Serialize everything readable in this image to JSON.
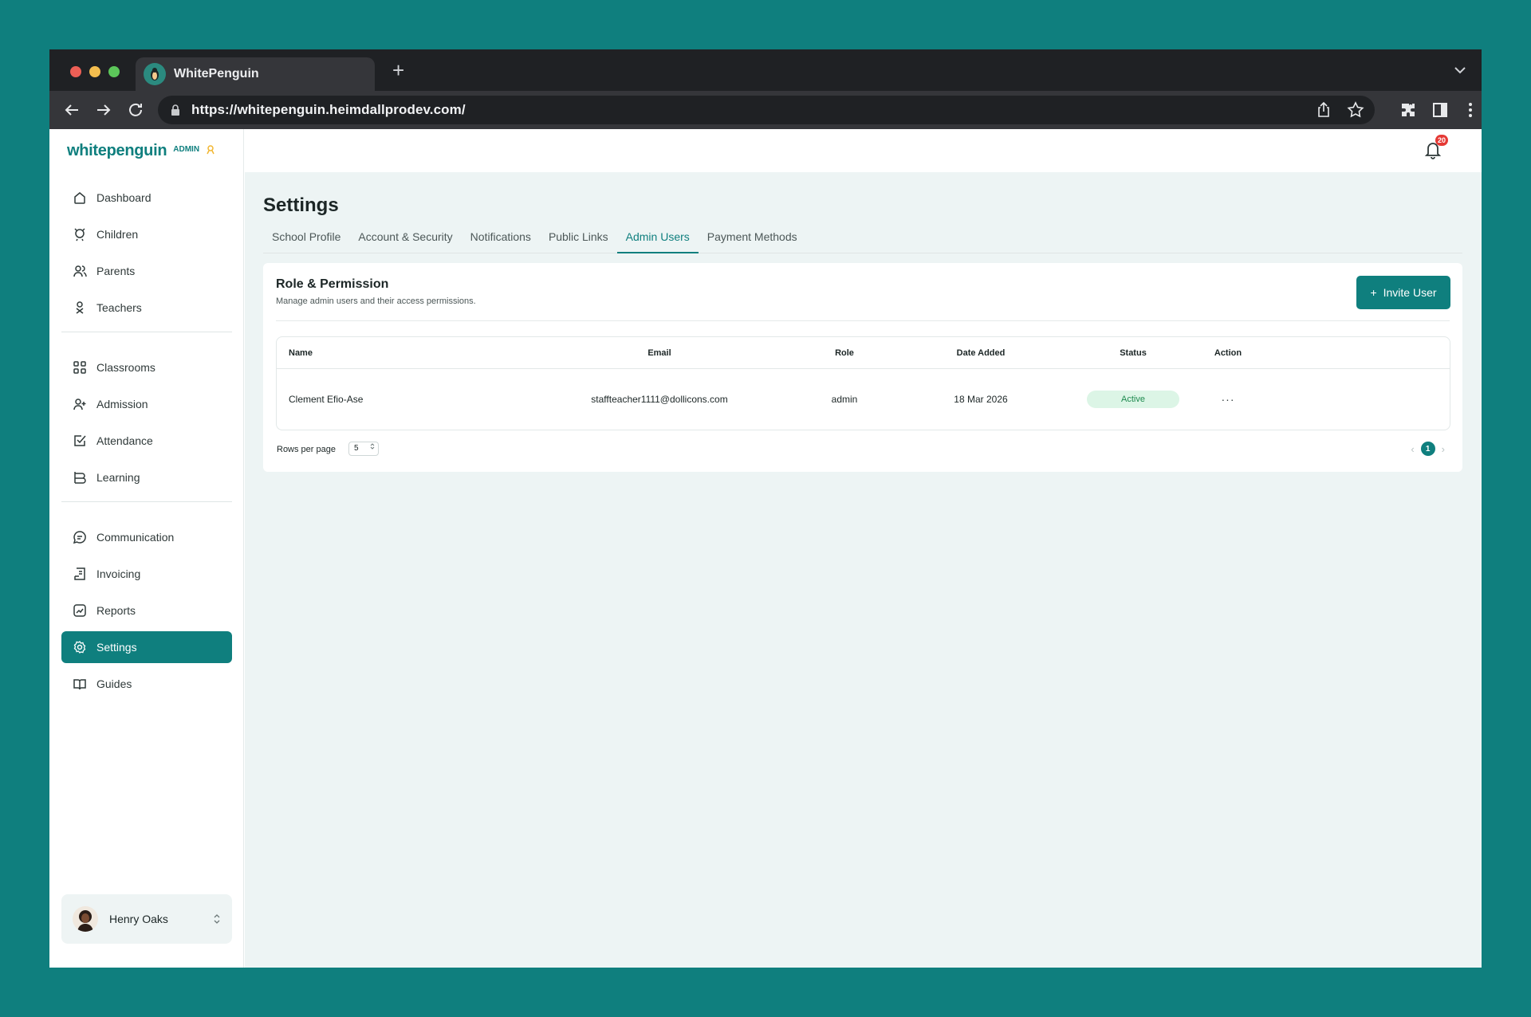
{
  "browser": {
    "tab_title": "WhitePenguin",
    "new_tab_symbol": "+",
    "url": "https://whitepenguin.heimdallprodev.com/"
  },
  "brand": {
    "wordmark": "whitepenguin",
    "badge": "ADMIN",
    "accent": "#0f7f7e"
  },
  "sidebar": {
    "groups": [
      [
        {
          "label": "Dashboard",
          "icon": "home-icon"
        },
        {
          "label": "Children",
          "icon": "child-icon"
        },
        {
          "label": "Parents",
          "icon": "users-icon"
        },
        {
          "label": "Teachers",
          "icon": "teacher-icon"
        }
      ],
      [
        {
          "label": "Classrooms",
          "icon": "grid-icon"
        },
        {
          "label": "Admission",
          "icon": "user-add-icon"
        },
        {
          "label": "Attendance",
          "icon": "check-square-icon"
        },
        {
          "label": "Learning",
          "icon": "book-icon"
        }
      ],
      [
        {
          "label": "Communication",
          "icon": "chat-icon"
        },
        {
          "label": "Invoicing",
          "icon": "invoice-icon"
        },
        {
          "label": "Reports",
          "icon": "chart-icon"
        },
        {
          "label": "Settings",
          "icon": "gear-icon",
          "active": true
        },
        {
          "label": "Guides",
          "icon": "open-book-icon"
        }
      ]
    ],
    "user": {
      "name": "Henry Oaks"
    }
  },
  "topbar": {
    "notification_count": "20"
  },
  "settings": {
    "title": "Settings",
    "tabs": [
      {
        "label": "School Profile"
      },
      {
        "label": "Account & Security"
      },
      {
        "label": "Notifications"
      },
      {
        "label": "Public Links"
      },
      {
        "label": "Admin Users",
        "active": true
      },
      {
        "label": "Payment Methods"
      }
    ],
    "card": {
      "title": "Role & Permission",
      "subtitle": "Manage admin users and their access permissions.",
      "invite_label": "Invite User",
      "invite_symbol": "+"
    },
    "table": {
      "headers": {
        "name": "Name",
        "email": "Email",
        "role": "Role",
        "date": "Date Added",
        "status": "Status",
        "action": "Action"
      },
      "rows": [
        {
          "name": "Clement Efio-Ase",
          "email": "staffteacher1111@dollicons.com",
          "role": "admin",
          "date": "18 Mar 2026",
          "status": "Active",
          "action": "···"
        }
      ]
    },
    "pagination": {
      "rows_per_page_label": "Rows per page",
      "rows_per_page_value": "5",
      "current_page": "1",
      "prev_symbol": "‹",
      "next_symbol": "›"
    }
  }
}
